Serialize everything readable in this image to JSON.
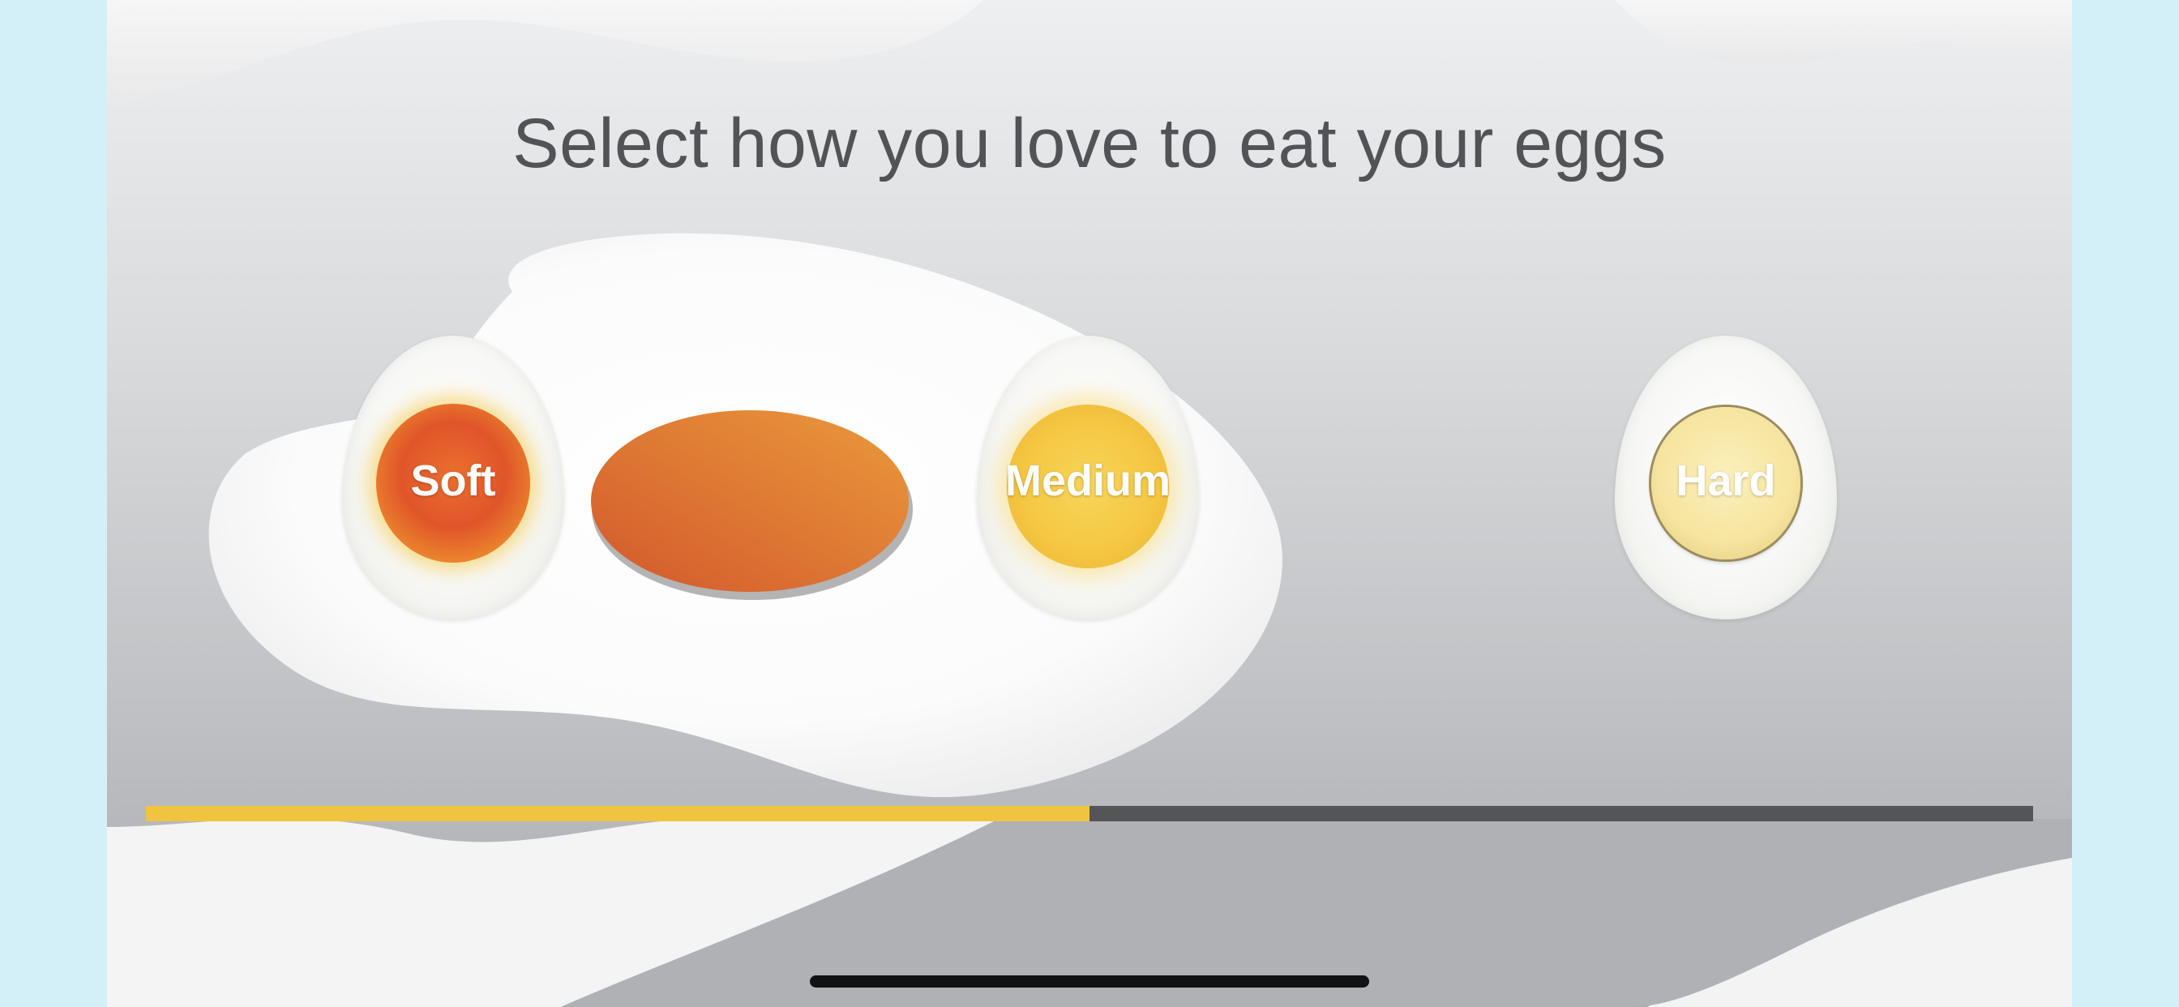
{
  "prompt": {
    "title": "Select how you love to eat your eggs"
  },
  "options": [
    {
      "id": "soft",
      "label": "Soft"
    },
    {
      "id": "medium",
      "label": "Medium"
    },
    {
      "id": "hard",
      "label": "Hard"
    }
  ],
  "selector": {
    "selected": "medium",
    "progress": 0.5
  },
  "colors": {
    "accent": "#f0c43f",
    "track": "#545556",
    "title_text": "#515356",
    "outer_background": "#d3f0f8"
  }
}
